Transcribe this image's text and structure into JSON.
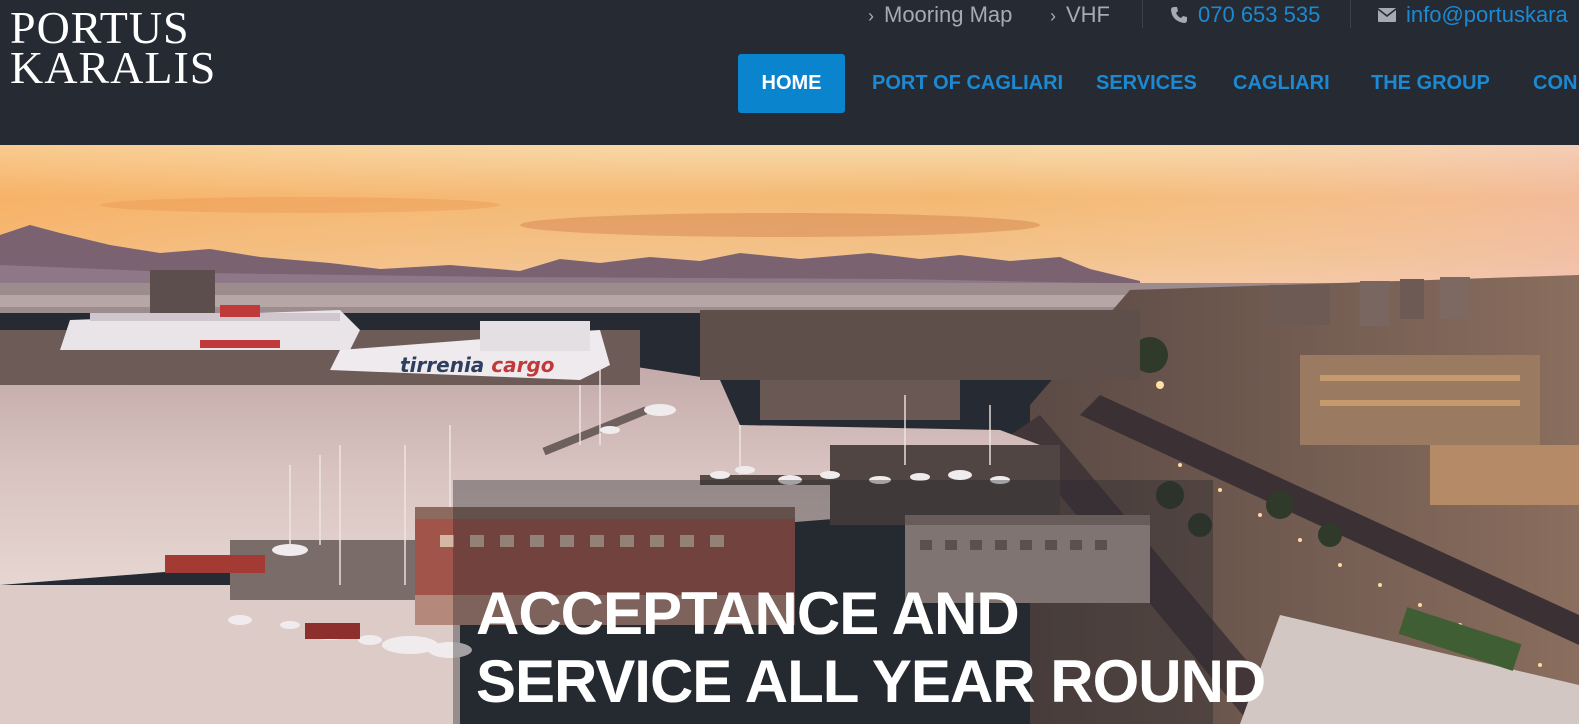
{
  "logo": {
    "line1": "PORTUS",
    "line2": "KARALIS"
  },
  "topbar": {
    "mooring_map": "Mooring Map",
    "vhf": "VHF",
    "phone": "070 653 535",
    "email": "info@portuskara"
  },
  "icons": {
    "chevron": "›",
    "phone": "phone-icon",
    "email": "envelope-icon"
  },
  "nav": {
    "items": [
      {
        "label": "HOME",
        "active": true
      },
      {
        "label": "PORT OF CAGLIARI",
        "active": false
      },
      {
        "label": "SERVICES",
        "active": false
      },
      {
        "label": "CAGLIARI",
        "active": false
      },
      {
        "label": "THE GROUP",
        "active": false
      },
      {
        "label": "CON",
        "active": false
      }
    ]
  },
  "hero": {
    "line1": "ACCEPTANCE AND",
    "line2": "SERVICE ALL YEAR ROUND",
    "ship_text": "tirrenia cargo",
    "ship_text2": "tirrenia"
  },
  "colors": {
    "header_bg": "#262a33",
    "accent": "#0b84ce",
    "link": "#1b8ad3",
    "muted": "#a6abb3"
  }
}
